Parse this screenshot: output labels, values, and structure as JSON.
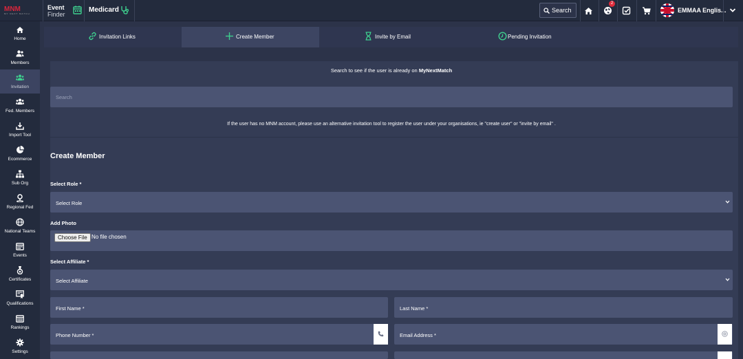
{
  "topbar": {
    "logo_text": "MNM",
    "logo_sub": "MY NEXT MATCH",
    "event_finder_line1": "Event",
    "event_finder_line2": "Finder",
    "org_name": "Medicard",
    "search_label": "Search",
    "notification_count": "2",
    "user_name": "EMMAA Englis..."
  },
  "sidebar": {
    "items": [
      {
        "label": "Home",
        "icon": "home-icon"
      },
      {
        "label": "Members",
        "icon": "members-icon"
      },
      {
        "label": "Invitation",
        "icon": "invitation-icon"
      },
      {
        "label": "Fed. Members",
        "icon": "fed-members-icon"
      },
      {
        "label": "Import Tool",
        "icon": "import-icon"
      },
      {
        "label": "Ecommerce",
        "icon": "pie-chart-icon"
      },
      {
        "label": "Sub Org",
        "icon": "sitemap-icon"
      },
      {
        "label": "Regional Fed",
        "icon": "map-pin-icon"
      },
      {
        "label": "National Teams",
        "icon": "globe-icon"
      },
      {
        "label": "Events",
        "icon": "calendar-icon"
      },
      {
        "label": "Certificates",
        "icon": "medal-icon"
      },
      {
        "label": "Qualifications",
        "icon": "certificate-icon"
      },
      {
        "label": "Rankings",
        "icon": "rankings-icon"
      },
      {
        "label": "Settings",
        "icon": "gear-icon"
      }
    ],
    "active_index": 2
  },
  "tabs": [
    {
      "label": "Invitation Links",
      "icon": "link-icon"
    },
    {
      "label": "Create Member",
      "icon": "plus-icon"
    },
    {
      "label": "Invite by Email",
      "icon": "hourglass-icon"
    },
    {
      "label": "Pending Invitation",
      "icon": "clock-icon"
    }
  ],
  "lookup": {
    "title_prefix": "Search to see if the user is already on ",
    "title_brand": "MyNextMatch",
    "search_placeholder": "Search",
    "note": "If the user has no MNM account, please use an alternative invitation tool to register the user under your organisations, ie \"create user\" or \"invite by email\" ."
  },
  "form": {
    "heading": "Create Member",
    "role_label": "Select Role *",
    "role_value": "Select Role",
    "photo_label": "Add Photo",
    "choose_file": "Choose File",
    "no_file": "No file chosen",
    "affiliate_label": "Select Affiliate *",
    "affiliate_value": "Select Affiliate",
    "first_name_placeholder": "First Name *",
    "last_name_placeholder": "Last Name *",
    "phone_placeholder": "Phone Number *",
    "email_placeholder": "Email Address *"
  },
  "colors": {
    "accent_green": "#3ecf8e",
    "brand_red": "#d7263d",
    "background": "#2c3349",
    "field": "#4b5473"
  }
}
